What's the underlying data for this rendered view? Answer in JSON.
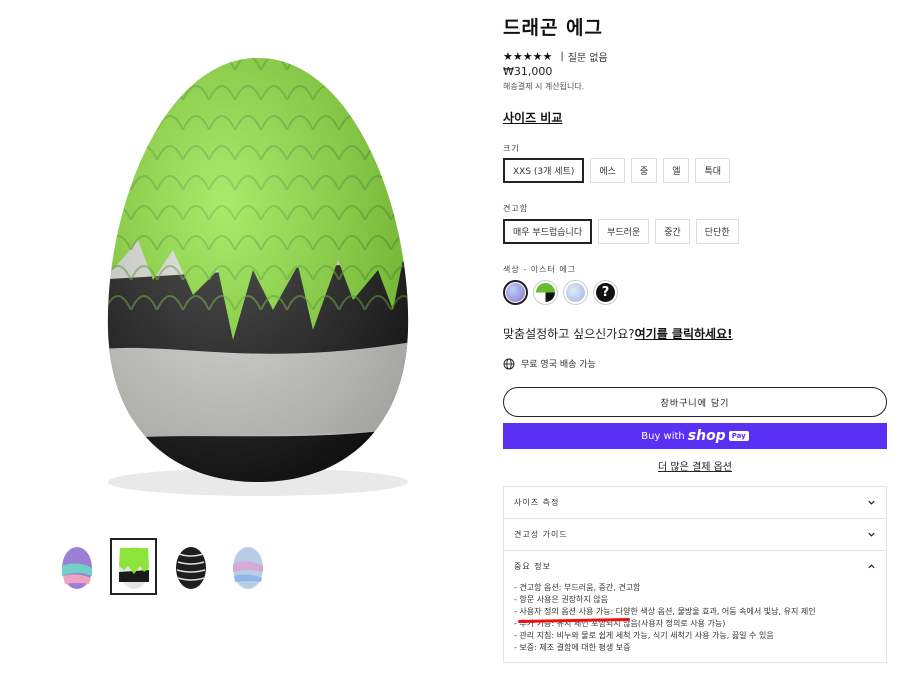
{
  "product": {
    "title": "드래곤 에그",
    "stars": "★★★★★",
    "reviews": "질문 없음",
    "price": "₩31,000",
    "tax_note": "해송결제 시 계산됩니다.",
    "size_compare": "사이즈 비교"
  },
  "options": {
    "size_label": "크기",
    "sizes": [
      "XXS (3개 세트)",
      "에스",
      "중",
      "엘",
      "특대"
    ],
    "selected_size": "XXS (3개 세트)",
    "firmness_label": "견고함",
    "firmness": [
      "매우 부드럽습니다",
      "부드러운",
      "중간",
      "단단한"
    ],
    "selected_firmness": "매우 부드럽습니다",
    "color_label": "색상",
    "color_value": "- 이스터 에그",
    "swatch_colors": [
      "#a98bd8",
      "#66bb33",
      "#b7cde8",
      "#111111"
    ]
  },
  "custom": {
    "question": "맞춤설정하고 싶으신가요?",
    "link": "여기를 클릭하세요!"
  },
  "shipping": "무료 영국 배송 가능",
  "actions": {
    "add_to_cart": "장바구니에 담기",
    "buy_with": "Buy with",
    "shop": "shop",
    "pay": "Pay",
    "more_payment": "더 많은 결제 옵션"
  },
  "accordion": {
    "items": [
      {
        "title": "사이즈 측정"
      },
      {
        "title": "견고성 가이드"
      },
      {
        "title": "중요 정보"
      }
    ],
    "info_lines": [
      "- 견고함 옵션: 부드러움, 중간, 견고함",
      "- 항문 사용은 권장하지 않음",
      "- 사용자 정의 옵션 사용 가능: 다양한 색상 옵션, 물방울 효과, 어둠 속에서 빛남, 유지 제인",
      "- 추가 기능: 유지 제인 포함되지 않음(사용자 정의로 사용 가능)",
      "- 관리 지침: 비누와 물로 쉽게 세척 가능, 식기 세척기 사용 가능, 끓일 수 있음",
      "- 보증: 제조 결함에 대한 평생 보증"
    ]
  },
  "colors": {
    "accent_purple": "#5a31f4",
    "egg_green": "#8de43a",
    "annotation_red": "#ee1111"
  }
}
